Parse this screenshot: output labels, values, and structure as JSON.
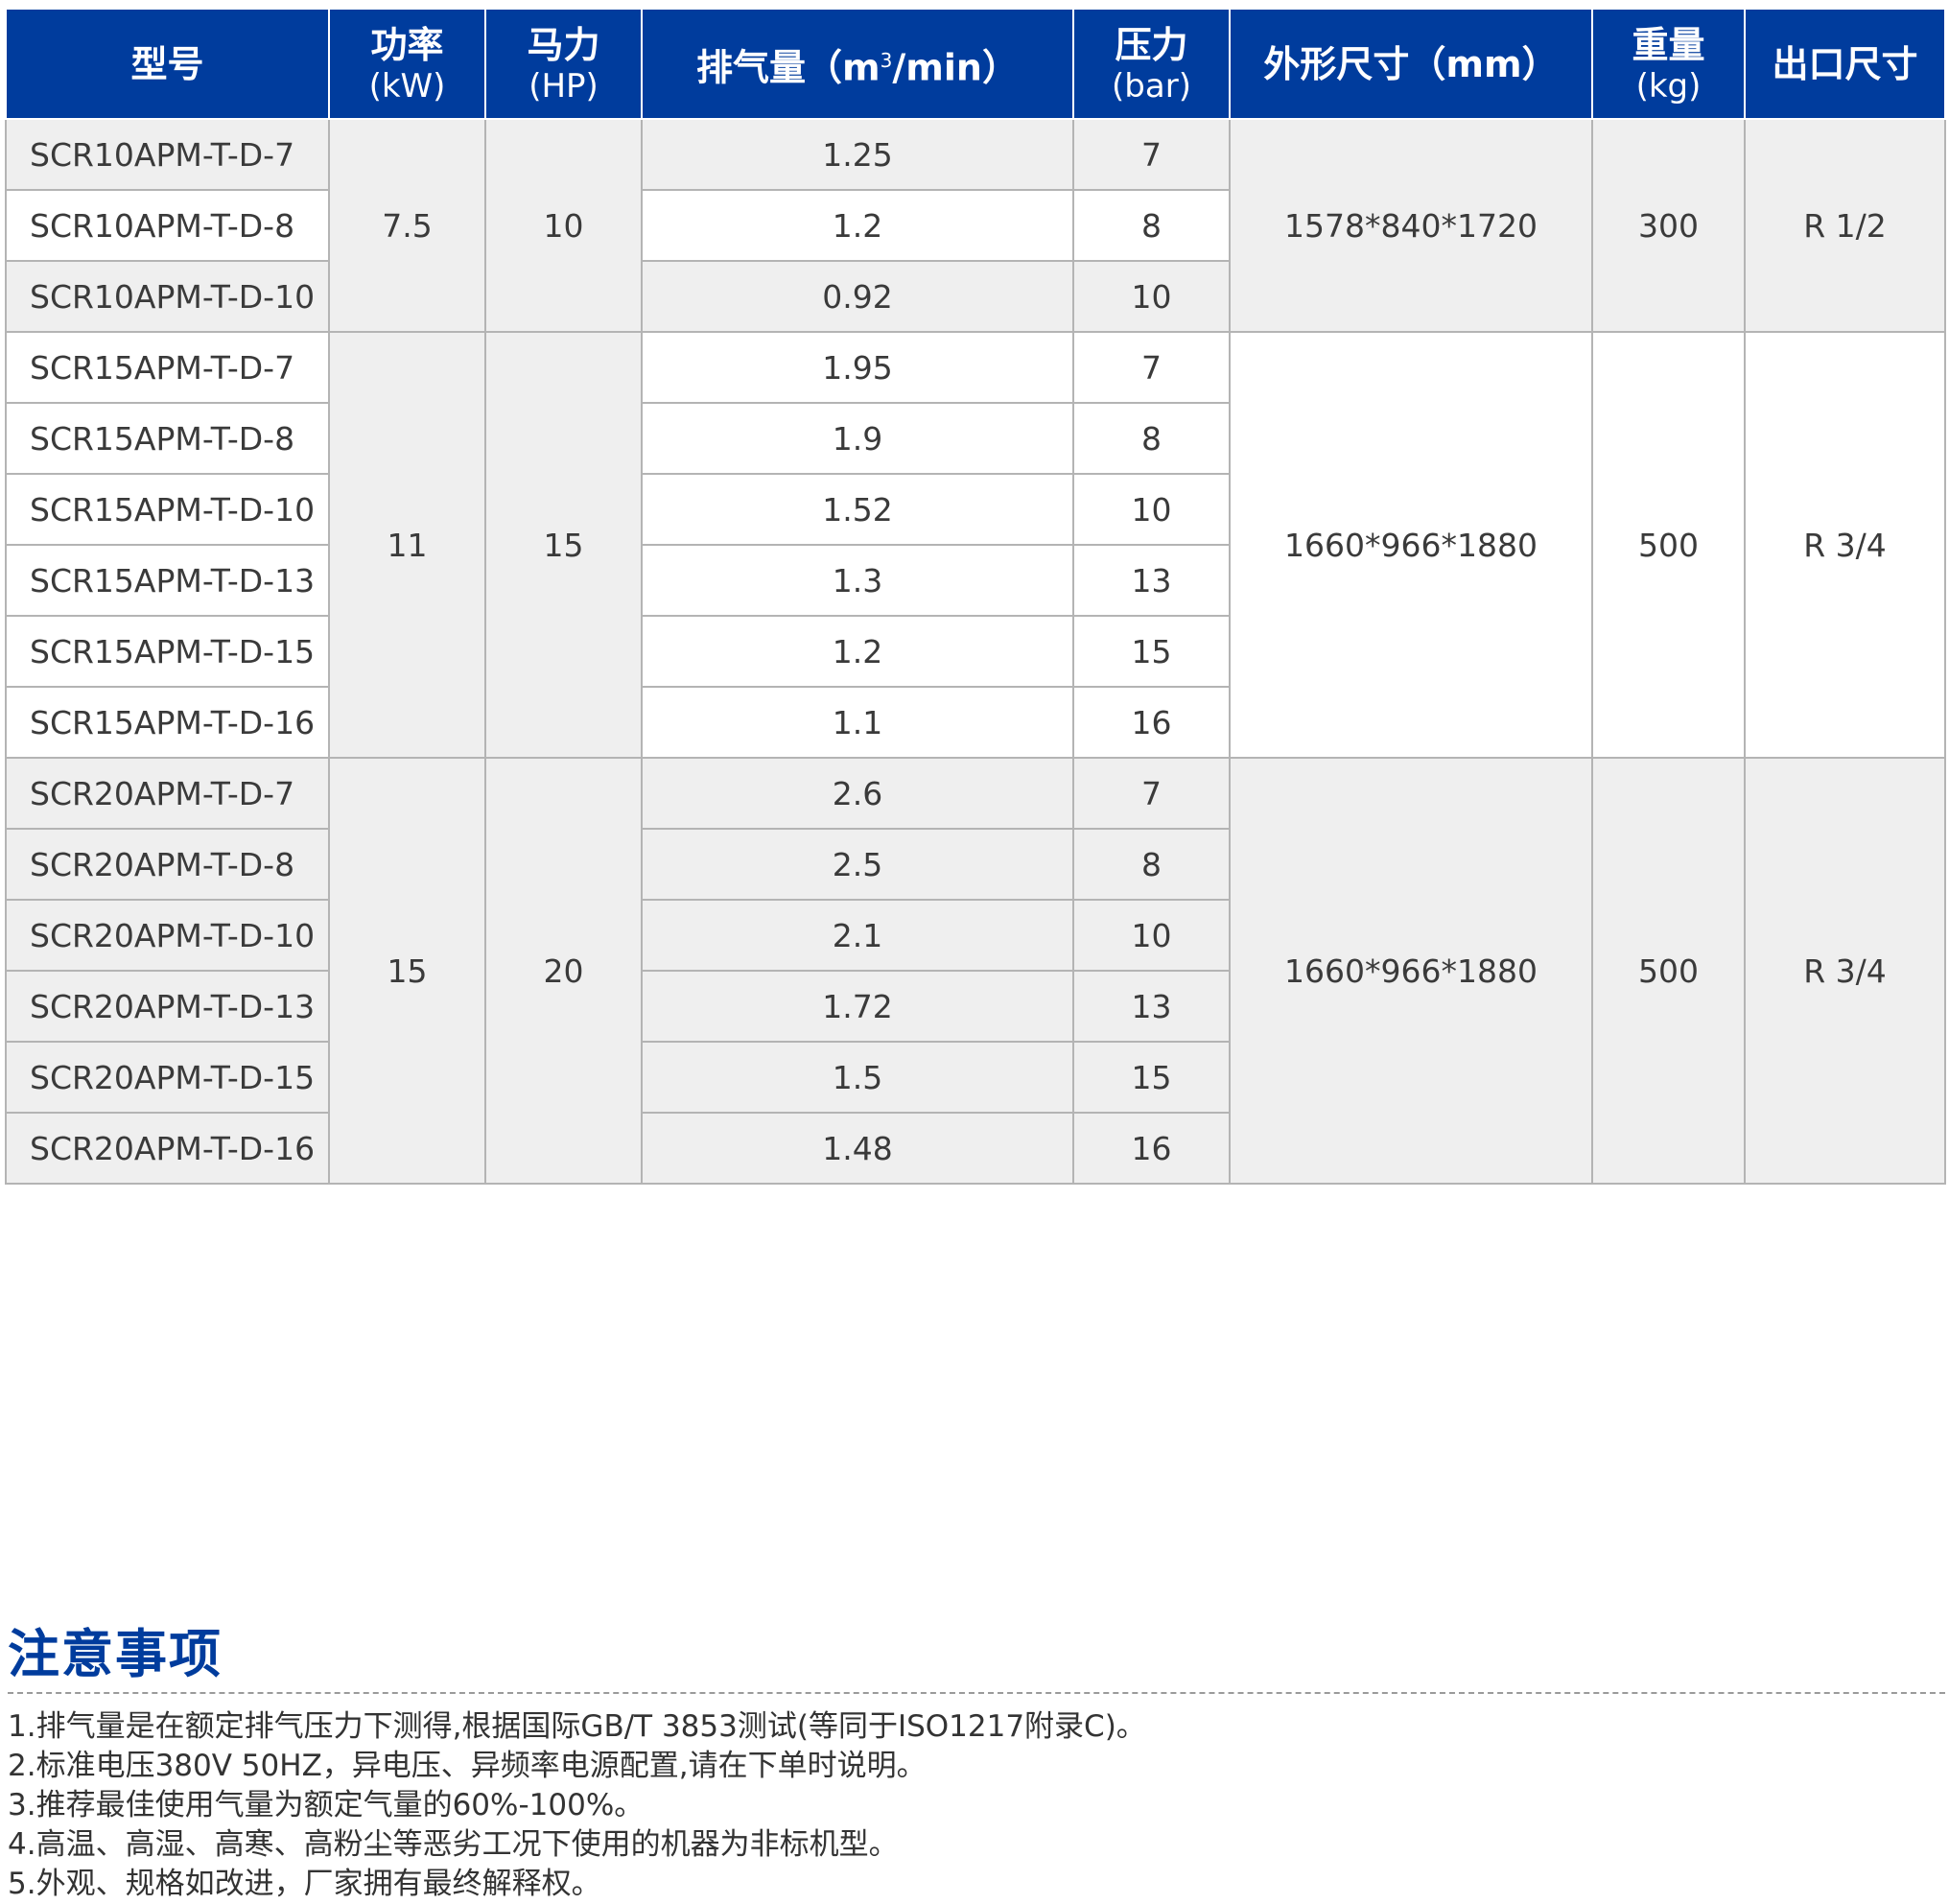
{
  "table": {
    "headers": {
      "model": "型号",
      "power": "功率",
      "power_unit": "(kW)",
      "hp": "马力",
      "hp_unit": "(HP)",
      "flow_prefix": "排气量（m",
      "flow_sup": "3",
      "flow_suffix": "/min）",
      "pressure": "压力",
      "pressure_unit": "(bar)",
      "dims": "外形尺寸（mm）",
      "weight": "重量",
      "weight_unit": "(kg)",
      "outlet": "出口尺寸"
    },
    "groups": [
      {
        "power": "7.5",
        "hp": "10",
        "dims": "1578*840*1720",
        "weight": "300",
        "outlet": "R 1/2",
        "rows": [
          {
            "model": "SCR10APM-T-D-7",
            "flow": "1.25",
            "pressure": "7"
          },
          {
            "model": "SCR10APM-T-D-8",
            "flow": "1.2",
            "pressure": "8"
          },
          {
            "model": "SCR10APM-T-D-10",
            "flow": "0.92",
            "pressure": "10"
          }
        ]
      },
      {
        "power": "11",
        "hp": "15",
        "dims": "1660*966*1880",
        "weight": "500",
        "outlet": "R 3/4",
        "rows": [
          {
            "model": "SCR15APM-T-D-7",
            "flow": "1.95",
            "pressure": "7"
          },
          {
            "model": "SCR15APM-T-D-8",
            "flow": "1.9",
            "pressure": "8"
          },
          {
            "model": "SCR15APM-T-D-10",
            "flow": "1.52",
            "pressure": "10"
          },
          {
            "model": "SCR15APM-T-D-13",
            "flow": "1.3",
            "pressure": "13"
          },
          {
            "model": "SCR15APM-T-D-15",
            "flow": "1.2",
            "pressure": "15"
          },
          {
            "model": "SCR15APM-T-D-16",
            "flow": "1.1",
            "pressure": "16"
          }
        ]
      },
      {
        "power": "15",
        "hp": "20",
        "dims": "1660*966*1880",
        "weight": "500",
        "outlet": "R 3/4",
        "rows": [
          {
            "model": "SCR20APM-T-D-7",
            "flow": "2.6",
            "pressure": "7"
          },
          {
            "model": "SCR20APM-T-D-8",
            "flow": "2.5",
            "pressure": "8"
          },
          {
            "model": "SCR20APM-T-D-10",
            "flow": "2.1",
            "pressure": "10"
          },
          {
            "model": "SCR20APM-T-D-13",
            "flow": "1.72",
            "pressure": "13"
          },
          {
            "model": "SCR20APM-T-D-15",
            "flow": "1.5",
            "pressure": "15"
          },
          {
            "model": "SCR20APM-T-D-16",
            "flow": "1.48",
            "pressure": "16"
          }
        ]
      }
    ]
  },
  "notes": {
    "title": "注意事项",
    "items": [
      "1.排气量是在额定排气压力下测得,根据国际GB/T 3853测试(等同于ISO1217附录C)。",
      "2.标准电压380V 50HZ，异电压、异频率电源配置,请在下单时说明。",
      "3.推荐最佳使用气量为额定气量的60%-100%。",
      "4.高温、高湿、高寒、高粉尘等恶劣工况下使用的机器为非标机型。",
      "5.外观、规格如改进，厂家拥有最终解释权。"
    ]
  },
  "colors": {
    "header_bg": "#003c9d",
    "header_text": "#ffffff",
    "stripe_bg": "#efefef",
    "border": "#b4b4b4",
    "notes_title": "#003c9d"
  }
}
